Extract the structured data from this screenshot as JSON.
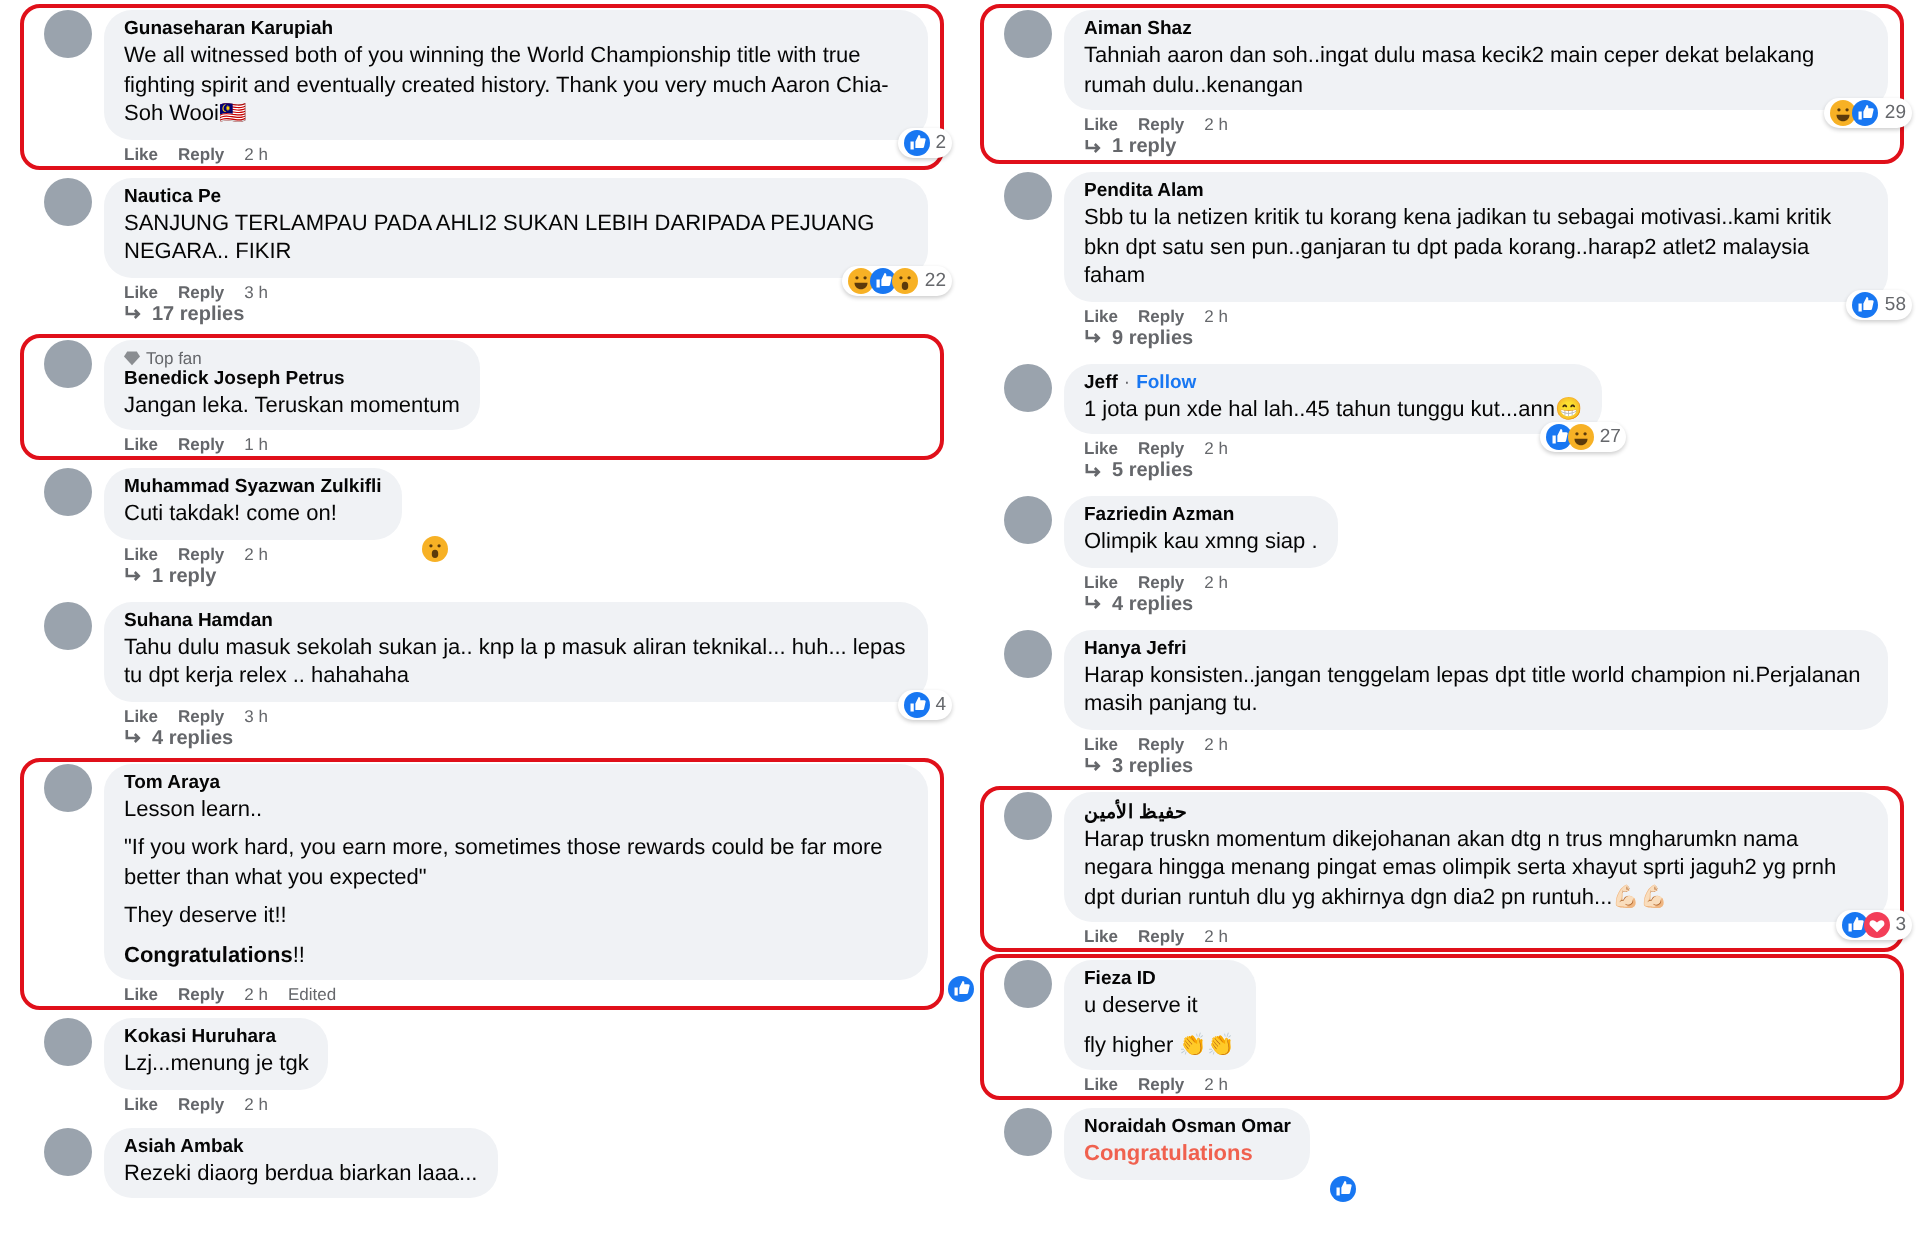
{
  "columns": [
    {
      "comments": [
        {
          "author": "Gunaseharan Karupiah",
          "paragraphs": [
            "We all witnessed both of you winning the World Championship title with true fighting spirit and eventually created history. Thank you very much Aaron Chia-Soh Wooi🇲🇾"
          ],
          "highlighted": true,
          "reactions": [
            {
              "kind": "like"
            }
          ],
          "reaction_count": "2",
          "like_label": "Like",
          "reply_label": "Reply",
          "time": "2 h"
        },
        {
          "author": "Nautica Pe",
          "paragraphs": [
            "SANJUNG TERLAMPAU PADA AHLI2 SUKAN LEBIH DARIPADA PEJUANG NEGARA.. FIKIR"
          ],
          "highlighted": false,
          "reactions": [
            {
              "kind": "haha"
            },
            {
              "kind": "like"
            },
            {
              "kind": "wow"
            }
          ],
          "reaction_count": "22",
          "like_label": "Like",
          "reply_label": "Reply",
          "time": "3 h",
          "replies": "17 replies"
        },
        {
          "author": "Benedick Joseph Petrus",
          "badge": "Top fan",
          "paragraphs": [
            "Jangan leka. Teruskan momentum"
          ],
          "highlighted": true,
          "like_label": "Like",
          "reply_label": "Reply",
          "time": "1 h"
        },
        {
          "author": "Muhammad Syazwan Zulkifli",
          "paragraphs": [
            "Cuti takdak! come on!"
          ],
          "highlighted": false,
          "reactions": [
            {
              "kind": "wow"
            }
          ],
          "like_label": "Like",
          "reply_label": "Reply",
          "time": "2 h",
          "replies": "1 reply"
        },
        {
          "author": "Suhana Hamdan",
          "paragraphs": [
            "Tahu dulu masuk sekolah sukan ja.. knp la p masuk aliran teknikal... huh... lepas tu dpt kerja relex .. hahahaha"
          ],
          "highlighted": false,
          "reactions": [
            {
              "kind": "like"
            }
          ],
          "reaction_count": "4",
          "like_label": "Like",
          "reply_label": "Reply",
          "time": "3 h",
          "replies": "4 replies"
        },
        {
          "author": "Tom Araya",
          "paragraphs": [
            "Lesson learn..",
            "\"If you work hard, you earn more, sometimes those rewards could be far more better than what you expected\"",
            "They deserve it!!",
            "**Congratulations**!!"
          ],
          "highlighted": true,
          "reactions": [
            {
              "kind": "like"
            }
          ],
          "like_label": "Like",
          "reply_label": "Reply",
          "time": "2 h",
          "edited": "Edited"
        },
        {
          "author": "Kokasi Huruhara",
          "paragraphs": [
            "Lzj...menung je tgk"
          ],
          "highlighted": false,
          "like_label": "Like",
          "reply_label": "Reply",
          "time": "2 h"
        },
        {
          "author": "Asiah Ambak",
          "paragraphs": [
            "Rezeki diaorg berdua biarkan laaa..."
          ],
          "highlighted": false
        }
      ]
    },
    {
      "comments": [
        {
          "author": "Aiman Shaz",
          "paragraphs": [
            "Tahniah aaron dan soh..ingat dulu masa kecik2 main ceper dekat belakang rumah dulu..kenangan"
          ],
          "highlighted": true,
          "reactions": [
            {
              "kind": "haha"
            },
            {
              "kind": "like"
            }
          ],
          "reaction_count": "29",
          "like_label": "Like",
          "reply_label": "Reply",
          "time": "2 h",
          "replies": "1 reply"
        },
        {
          "author": "Pendita Alam",
          "paragraphs": [
            "Sbb tu la netizen kritik tu korang kena jadikan tu sebagai motivasi..kami kritik bkn dpt satu sen pun..ganjaran tu dpt pada korang..harap2 atlet2 malaysia faham"
          ],
          "highlighted": false,
          "reactions": [
            {
              "kind": "like"
            }
          ],
          "reaction_count": "58",
          "like_label": "Like",
          "reply_label": "Reply",
          "time": "2 h",
          "replies": "9 replies"
        },
        {
          "author": "Jeff",
          "follow_separator": "·",
          "follow": "Follow",
          "paragraphs": [
            "1 jota pun xde hal lah..45 tahun tunggu kut...ann😁"
          ],
          "highlighted": false,
          "reactions": [
            {
              "kind": "like"
            },
            {
              "kind": "haha"
            }
          ],
          "reaction_count": "27",
          "like_label": "Like",
          "reply_label": "Reply",
          "time": "2 h",
          "replies": "5 replies"
        },
        {
          "author": "Fazriedin Azman",
          "paragraphs": [
            "Olimpik kau xmng siap ."
          ],
          "highlighted": false,
          "like_label": "Like",
          "reply_label": "Reply",
          "time": "2 h",
          "replies": "4 replies"
        },
        {
          "author": "Hanya Jefri",
          "paragraphs": [
            "Harap konsisten..jangan tenggelam lepas dpt title world champion ni.Perjalanan masih panjang tu."
          ],
          "highlighted": false,
          "like_label": "Like",
          "reply_label": "Reply",
          "time": "2 h",
          "replies": "3 replies"
        },
        {
          "author": "حفيظ الأمين",
          "paragraphs": [
            "Harap truskn momentum dikejohanan akan dtg n trus mngharumkn nama negara hingga menang pingat emas olimpik serta xhayut sprti jaguh2 yg prnh dpt durian runtuh dlu yg akhirnya dgn dia2 pn runtuh...💪🏻💪🏻"
          ],
          "highlighted": true,
          "reactions": [
            {
              "kind": "like"
            },
            {
              "kind": "love"
            }
          ],
          "reaction_count": "3",
          "like_label": "Like",
          "reply_label": "Reply",
          "time": "2 h"
        },
        {
          "author": "Fieza ID",
          "paragraphs": [
            "u deserve it",
            "fly higher 👏👏"
          ],
          "highlighted": true,
          "like_label": "Like",
          "reply_label": "Reply",
          "time": "2 h"
        },
        {
          "author": "Noraidah Osman Omar",
          "paragraphs": [
            "Congratulations"
          ],
          "celebration": true,
          "highlighted": false,
          "reactions": [
            {
              "kind": "like"
            }
          ]
        }
      ]
    }
  ]
}
